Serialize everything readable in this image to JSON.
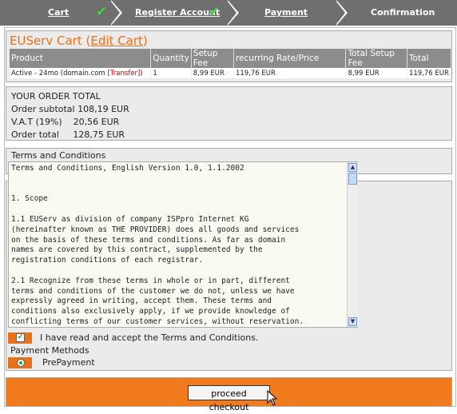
{
  "steps": [
    {
      "label": "Cart",
      "done": true
    },
    {
      "label": "Register Account",
      "done": true
    },
    {
      "label": "Payment",
      "done": false
    },
    {
      "label": "Confirmation",
      "done": false
    }
  ],
  "cart": {
    "title": "EUServ Cart",
    "edit_link": "Edit Cart",
    "columns": [
      "Product",
      "Quantity",
      "Setup Fee",
      "recurring Rate/Price",
      "Total Setup Fee",
      "Total"
    ],
    "row": {
      "product": "Active - 24mo (domain.com ",
      "transfer": "[Transfer]",
      "quantity": "1",
      "setup_fee": "8,99 EUR",
      "recurring": "119,76 EUR",
      "total_setup": "8,99 EUR",
      "total": "119,76 EUR"
    }
  },
  "order": {
    "heading": "YOUR ORDER TOTAL",
    "subtotal": "Order subtotal 108,19 EUR",
    "vat": "V.A.T (19%)    20,56 EUR",
    "total": "Order total     128,75 EUR"
  },
  "terms": {
    "heading": "Terms and Conditions",
    "text": "Terms and Conditions, English Version 1.0, 1.1.2002\n\n\n1. Scope\n\n1.1 EUServ as division of company ISPpro Internet KG\n(hereinafter known as THE PROVIDER) does all goods and services\non the basis of these terms and conditions. As far as domain\nnames are covered by this contract, supplemented by the\nregistration conditions of each registrar.\n\n2.1 Recognize from these terms in whole or in part, different\nterms and conditions of the customer we do not, unless we have\nexpressly agreed in writing, accept them. These terms and\nconditions also exclusively apply, if we provide knowledge of\nconflicting terms of our customer services, without reservation.",
    "accept_label": "I have read and accept the Terms and Conditions.",
    "accepted": true
  },
  "payment": {
    "heading": "Payment Methods",
    "option": "PrePayment",
    "selected": true
  },
  "checkout_label": "proceed checkout",
  "colors": {
    "accent": "#e8711a",
    "step_bar": "#6f6f6f",
    "check": "#4bd24b"
  }
}
